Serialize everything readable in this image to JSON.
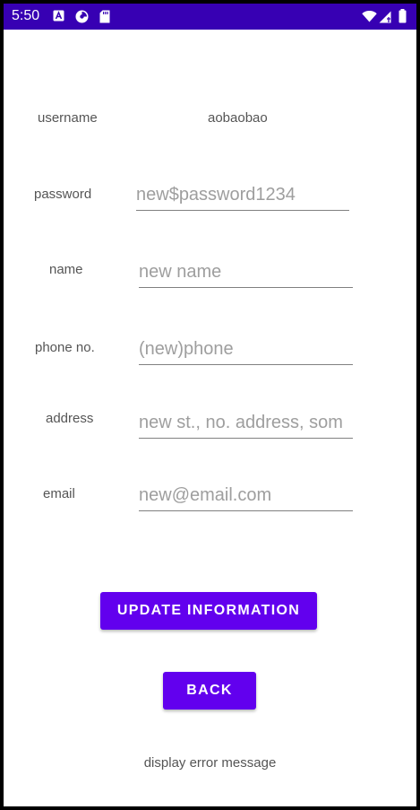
{
  "status_bar": {
    "time": "5:50",
    "icons": [
      "notification-a-icon",
      "data-saver-icon",
      "sd-card-icon",
      "wifi-icon",
      "signal-icon",
      "battery-icon"
    ],
    "color": "#3700B3"
  },
  "form": {
    "username": {
      "label": "username",
      "value": "aobaobao"
    },
    "password": {
      "label": "password",
      "placeholder": "new$password1234"
    },
    "name": {
      "label": "name",
      "placeholder": "new name"
    },
    "phone": {
      "label": "phone no.",
      "placeholder": "(new)phone"
    },
    "address": {
      "label": "address",
      "placeholder": "new st., no. address, som"
    },
    "email": {
      "label": "email",
      "placeholder": "new@email.com"
    }
  },
  "buttons": {
    "update_label": "UPDATE INFORMATION",
    "back_label": "BACK",
    "color": "#6200EE"
  },
  "message": "display error message"
}
